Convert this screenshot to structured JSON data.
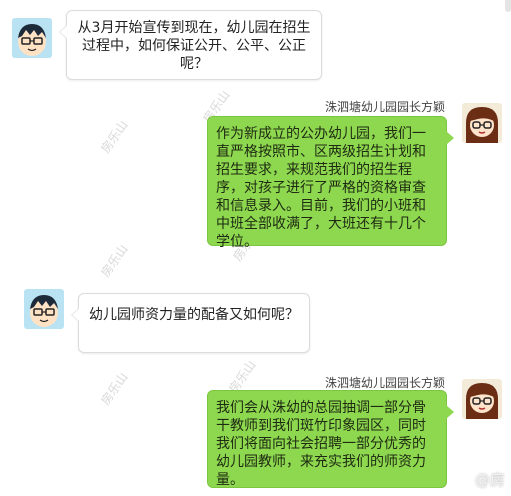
{
  "messages": [
    {
      "side": "left",
      "text": "从3月开始宣传到现在，幼儿园在招生过程中，如何保证公开、公平、公正呢？"
    },
    {
      "side": "right",
      "sender": "洙泗塘幼儿园园长方颖",
      "text": "作为新成立的公办幼儿园，我们一直严格按照市、区两级招生计划和招生要求，来规范我们的招生程序，对孩子进行了严格的资格审查和信息录入。目前，我们的小班和中班全部收满了，大班还有十几个学位。"
    },
    {
      "side": "left",
      "text": "幼儿园师资力量的配备又如何呢？"
    },
    {
      "side": "right",
      "sender": "洙泗塘幼儿园园长方颖",
      "text": "我们会从洙幼的总园抽调一部分骨干教师到我们斑竹印象园区，同时我们将面向社会招聘一部分优秀的幼儿园教师，来充实我们的师资力量。"
    }
  ],
  "watermark": {
    "text": "房乐山",
    "corner": "@房"
  },
  "colors": {
    "right_bubble": "#8ed84f",
    "left_bubble": "#ffffff"
  },
  "avatars": {
    "left": "reporter-avatar-icon",
    "right": "principal-avatar-icon"
  }
}
